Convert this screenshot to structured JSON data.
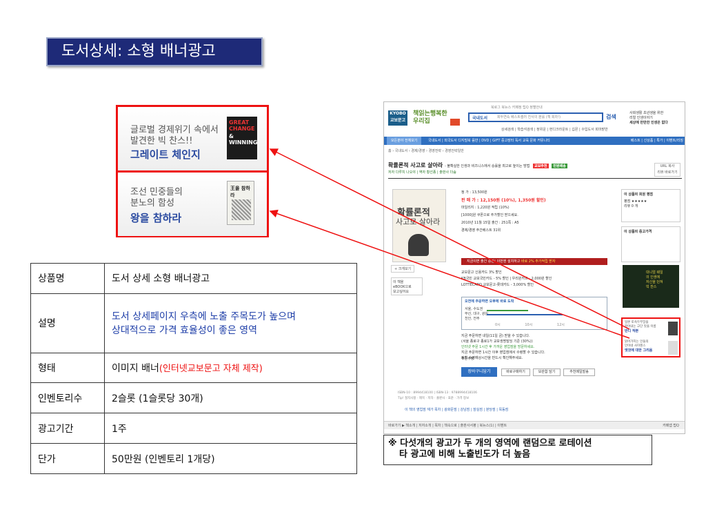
{
  "slide": {
    "title": "도서상세: 소형 배너광고"
  },
  "banners": [
    {
      "line1": "글로벌 경제위기 속에서",
      "line2": "발견한 빅 찬스!!",
      "main": "그레이트 체인지",
      "cover_text1": "GREAT CHANGE",
      "cover_text2": "& WINNING"
    },
    {
      "line1": "조선 민중들의",
      "line2": "분노의 함성",
      "main": "왕을 참하라",
      "cover_text": "王을 참하라"
    }
  ],
  "spec_table": {
    "rows": [
      {
        "key": "상품명",
        "value": "도서 상세 소형 배너광고"
      },
      {
        "key": "설명",
        "value_lines": [
          "도서 상세페이지 우측에 노출 주목도가 높으며",
          "상대적으로 가격 효율성이 좋은 영역"
        ]
      },
      {
        "key": "형태",
        "value": "이미지 배너",
        "value_red": "(인터넷교보문고 자체 제작)"
      },
      {
        "key": "인벤토리수",
        "value": "2슬롯 (1슬롯당 30개)"
      },
      {
        "key": "광고기간",
        "value": "1주"
      },
      {
        "key": "단가",
        "value": "50만원 (인벤토리 1개당)"
      }
    ]
  },
  "screenshot": {
    "logo": "KYOBO 교보문고",
    "slogan": "책읽는행복한 우리집",
    "top_menu": "북로그 북뉴스 카페정 팁Q 정별안내",
    "search_category": "국내도서",
    "search_placeholder": "회두연속 베스트셀러 진사의 분를 (책 회차!)",
    "search_button": "검색",
    "sub_links": "상세검색 | 학습석검색 | 정위운 | 현디크라운트 | 깁몬 | 수입도서 회마밭반",
    "ad_top_lines": [
      "사회생활 초년생을 위한",
      "리얼 인생이야기",
      "세상에 만만한 인생은 없다"
    ],
    "nav_all": "모든분야 전체보기",
    "nav_items": "국내도서 | 외국도서   디지털북   음반 | DVD | GIFT   중고장터   독서   교육   문화   커뮤니티",
    "nav_right": "베스트 | 신상품 | 특가 | 이벤트/리징",
    "breadcrumb": "홈 › 국내도서 › 경제/경영 › 경영전략 › 경영전략일반",
    "book_title": "확률론적 사고로 살아라",
    "book_subtitle": "- 불확실한 인생과 비즈니스에서 승률을 최고로 높이는 방법",
    "badge_red": "교보추천",
    "badge_green": "만원배송",
    "author_line": "저자 다루치 나오야 | 역자 황선종 | 출판사 더숲",
    "url_buttons": [
      "URL 복사",
      "리뷰 바로가기"
    ],
    "cover_title1": "확률론적",
    "cover_title2": "사고로 살아라",
    "zoom_btn": "+ 크게보기",
    "ebook_box": [
      "이 책을",
      "eBOOK으로",
      "보고싶어요"
    ],
    "price_lines": [
      "정   가 : 13,500원",
      "판 매 가 : 12,150원 (10%), 1,350원 할인)",
      "마일리지 : 1,220원 적립 (10%)",
      "[1000]원 쿠폰으로 추가할인 받으세요.",
      "2010년 11월 15일 출간 : 251쪽 : A5",
      "경제/경영 주간베스트 31위"
    ],
    "sale_price": "12,150원",
    "red_bar": "지금이면 출간 승관! 이번엔 설치하고",
    "red_bar_highlight": "바로 2% 추가적립 받자",
    "card_lines": [
      "교보문고 신용카드 3% 할인",
      "KB국민 교보국민카드 - 5% 할인 | 우리원카드 - 2,000원 할인",
      "LOTTECARD 교보문고-롯데카드 - 3,000% 할인"
    ],
    "delivery_head": "오전에 주문하면 오후에 바로 도착",
    "delivery_areas": [
      "서울, 수도권",
      "부산, 대구, 광원,",
      "천안, 전주"
    ],
    "delivery_times": "0시 10시 12시",
    "delivery_note": [
      "지금 주문하면 내일(11일 금) 받을 수 있습니다.",
      "(서울 종로구 종로1가 교보생명빌딩 기준 (30%))"
    ],
    "delivery_note2": [
      "인터넷 주문 1시간 후 가까운 영업점을 방문하세요.",
      "지금 주문하면 1시간 이후 영업점에서 수령할 수 있습니다.",
      "정확 수령예상시간을 반드시 확인해주세요."
    ],
    "qty_label": "주문수량",
    "cart_button": "장바구니담기",
    "buy_buttons": [
      "바로구매하기",
      "보관함 담기",
      "추천메일발송"
    ],
    "isbn_lines": [
      "ISBN-10 : 8994418100 | ISBN-13 : 9788994418106",
      "Tip! 절지사항 · 제목 · 저자 · 출판사 · 표준 · 가격 정보"
    ],
    "tabs": "이 책의 영업점 재가 목차 | 광화문점 | 강남점 | 잠실점 | 분당점 | 목동점",
    "bottom_bar": "바로가기 ▶  책소개 | 저자소개 | 목차 | 책속으로 | 출판사서평 | 북뉴스(1) | 이벤트",
    "bottom_right": "카페앱   탑Q",
    "right_rating_title": "이 상품의 회원 평점",
    "right_rating_lines": [
      "평점 ★★★★★",
      "리뷰 0 개"
    ],
    "right_used_title": "이 상품의 중고가격",
    "right_book_text": [
      "대니얼 웨일",
      "의 인생에",
      "자신을 던져",
      "빅 찬스"
    ],
    "small_ads": [
      {
        "line": "일본 토속두부장을",
        "line2": "끌어내는 고단 맛을 이름",
        "bold": "반디 작본"
      },
      {
        "line": "읽어가지는 인들의",
        "line2": "인이네 사이렌스",
        "bold": "엣것에 대한 그리움"
      }
    ]
  },
  "note": {
    "line1": "※ 다섯개의 광고가 두 개의 영역에 랜덤으로 로테이션",
    "line2": "타 광고에 비해 노출빈도가 더 높음"
  },
  "colors": {
    "title_bg": "#1e2a78",
    "highlight_red": "#ee1111",
    "text_blue": "#1e3ea8"
  }
}
